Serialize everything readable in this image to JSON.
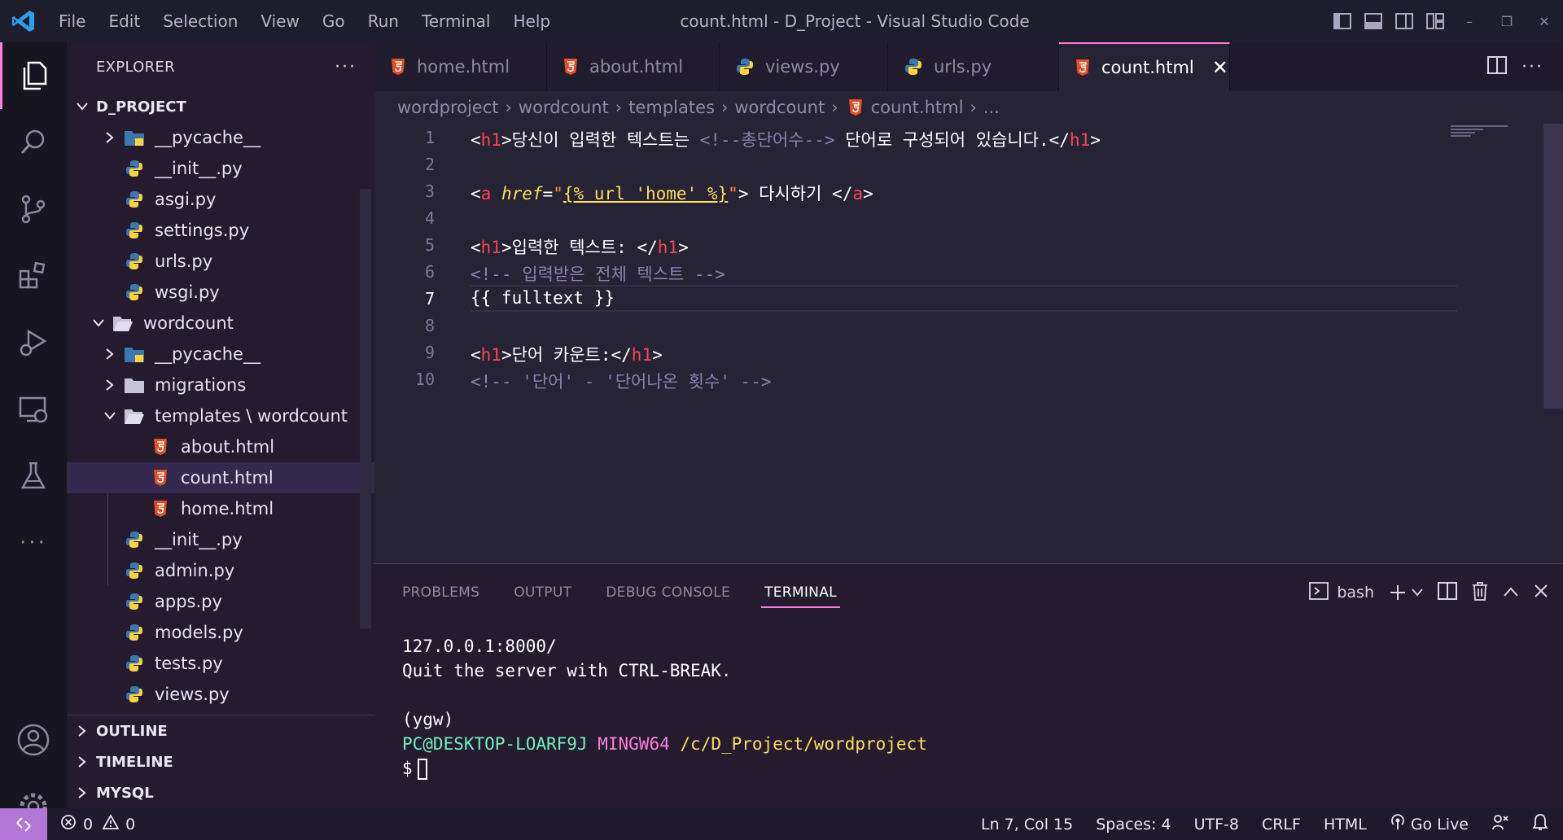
{
  "titlebar": {
    "menu": [
      "File",
      "Edit",
      "Selection",
      "View",
      "Go",
      "Run",
      "Terminal",
      "Help"
    ],
    "window_title": "count.html - D_Project - Visual Studio Code"
  },
  "colors": {
    "accent": "#ff7edb",
    "html_icon": "#e44d26",
    "py_blue": "#3b78b0",
    "py_yellow": "#ffd43b",
    "remote": "#b276d9"
  },
  "sidebar": {
    "title": "EXPLORER",
    "more": "···",
    "project": "D_PROJECT",
    "tree": [
      {
        "label": "__pycache__",
        "icon": "folder-pycache-icon"
      },
      {
        "label": "__init__.py",
        "icon": "python-icon"
      },
      {
        "label": "asgi.py",
        "icon": "python-icon"
      },
      {
        "label": "settings.py",
        "icon": "python-icon"
      },
      {
        "label": "urls.py",
        "icon": "python-icon"
      },
      {
        "label": "wsgi.py",
        "icon": "python-icon"
      },
      {
        "label": "wordcount",
        "icon": "folder-open-icon"
      },
      {
        "label": "__pycache__",
        "icon": "folder-pycache-icon"
      },
      {
        "label": "migrations",
        "icon": "folder-icon"
      },
      {
        "label": "templates \\ wordcount",
        "icon": "folder-open-icon"
      },
      {
        "label": "about.html",
        "icon": "html-icon"
      },
      {
        "label": "count.html",
        "icon": "html-icon"
      },
      {
        "label": "home.html",
        "icon": "html-icon"
      },
      {
        "label": "__init__.py",
        "icon": "python-icon"
      },
      {
        "label": "admin.py",
        "icon": "python-icon"
      },
      {
        "label": "apps.py",
        "icon": "python-icon"
      },
      {
        "label": "models.py",
        "icon": "python-icon"
      },
      {
        "label": "tests.py",
        "icon": "python-icon"
      },
      {
        "label": "views.py",
        "icon": "python-icon"
      }
    ],
    "sections": [
      "OUTLINE",
      "TIMELINE",
      "MYSQL"
    ]
  },
  "tabs": [
    {
      "label": "home.html",
      "icon": "html-icon"
    },
    {
      "label": "about.html",
      "icon": "html-icon"
    },
    {
      "label": "views.py",
      "icon": "python-icon"
    },
    {
      "label": "urls.py",
      "icon": "python-icon"
    },
    {
      "label": "count.html",
      "icon": "html-icon",
      "close": "✕"
    }
  ],
  "breadcrumb": [
    "wordproject",
    "wordcount",
    "templates",
    "wordcount",
    "count.html",
    "..."
  ],
  "editor": {
    "line_numbers": [
      "1",
      "2",
      "3",
      "4",
      "5",
      "6",
      "7",
      "8",
      "9",
      "10"
    ],
    "l1_text": "당신이 입력한 텍스트는 ",
    "l1_comment": "<!--총단어수-->",
    "l1_tail": " 단어로 구성되어 있습니다.",
    "tag_h1": "h1",
    "tag_a": "a",
    "l3_attr": "href",
    "l3_tmpl": "{% url 'home' %}",
    "l3_text": " 다시하기 ",
    "l5_text": "입력한 텍스트: ",
    "l6_comment": "<!-- 입력받은 전체 텍스트 -->",
    "l7_text": "{{ fulltext }}",
    "l9_text": "단어 카운트:",
    "l10_comment": "<!-- '단어' - '단어나온 횟수' -->"
  },
  "panel": {
    "tabs": [
      "PROBLEMS",
      "OUTPUT",
      "DEBUG CONSOLE",
      "TERMINAL"
    ],
    "shell": "bash",
    "terminal": {
      "line1": "127.0.0.1:8000/",
      "line2": "Quit the server with CTRL-BREAK.",
      "line3": "(ygw)",
      "user": "PC@DESKTOP-LOARF9J",
      "env": "MINGW64",
      "path": "/c/D_Project/wordproject",
      "prompt": "$"
    }
  },
  "statusbar": {
    "errors": "0",
    "warnings": "0",
    "position": "Ln 7, Col 15",
    "spaces": "Spaces: 4",
    "encoding": "UTF-8",
    "eol": "CRLF",
    "language": "HTML",
    "golive": "Go Live"
  }
}
